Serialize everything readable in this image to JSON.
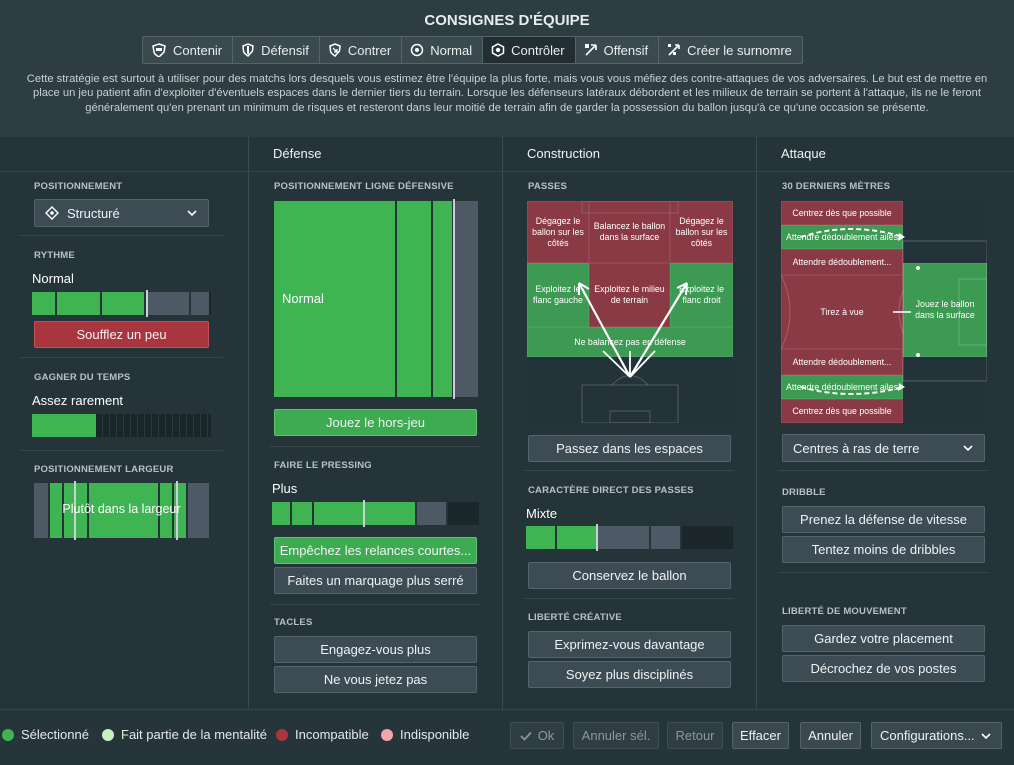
{
  "title": "CONSIGNES D'ÉQUIPE",
  "tabs": [
    {
      "label": "Contenir",
      "icon": "shield-hold-icon"
    },
    {
      "label": "Défensif",
      "icon": "shield-icon"
    },
    {
      "label": "Contrer",
      "icon": "counter-icon"
    },
    {
      "label": "Normal",
      "icon": "balance-icon"
    },
    {
      "label": "Contrôler",
      "icon": "control-icon",
      "active": true
    },
    {
      "label": "Offensif",
      "icon": "attack-icon"
    },
    {
      "label": "Créer le surnomre",
      "icon": "overload-icon"
    }
  ],
  "description": "Cette stratégie est surtout à utiliser pour des matchs lors desquels vous estimez être l'équipe la plus forte, mais vous vous méfiez des contre-attaques de vos adversaires. Le but est de mettre en place un jeu patient afin d'exploiter d'éventuels espaces dans le dernier tiers du terrain. Lorsque les défenseurs latéraux débordent et les milieux de terrain se portent à l'attaque, ils ne le feront généralement qu'en prenant un minimum de risques et resteront dans leur moitié de terrain afin de garder la possession du ballon jusqu'à ce qu'une occasion se présente.",
  "left": {
    "positioning_label": "POSITIONNEMENT",
    "positioning_value": "Structuré",
    "tempo_label": "RYTHME",
    "tempo_value": "Normal",
    "tempo_level": 0.6,
    "tempo_button": "Soufflez un peu",
    "timewasting_label": "GAGNER DU TEMPS",
    "timewasting_value": "Assez rarement",
    "timewasting_level": 0.35,
    "width_label": "POSITIONNEMENT LARGEUR",
    "width_value": "Plutôt dans la largeur"
  },
  "defense": {
    "header": "Défense",
    "line_label": "POSITIONNEMENT LIGNE DÉFENSIVE",
    "line_value": "Normal",
    "offside_button": "Jouez le hors-jeu",
    "press_label": "FAIRE LE PRESSING",
    "press_value": "Plus",
    "press_level": 0.71,
    "press_btn1": "Empêchez les relances courtes...",
    "press_btn2": "Faites un marquage plus serré",
    "tackle_label": "TACLES",
    "tackle_btn1": "Engagez-vous plus",
    "tackle_btn2": "Ne vous jetez pas"
  },
  "build": {
    "header": "Construction",
    "passes_label": "PASSES",
    "zones": {
      "tl": "Dégagez le ballon sur les côtés",
      "tc": "Balancez le ballon dans la surface",
      "tr": "Dégagez le ballon sur les côtés",
      "ml": "Exploitez le flanc gauche",
      "mc": "Exploitez le milieu de terrain",
      "mr": "Exploitez le flanc droit",
      "b": "Ne balancez pas en défense"
    },
    "spaces_button": "Passez dans les espaces",
    "direct_label": "CARACTÈRE DIRECT DES PASSES",
    "direct_value": "Mixte",
    "direct_level": 0.5,
    "keep_button": "Conservez le ballon",
    "creative_label": "LIBERTÉ CRÉATIVE",
    "creative_btn1": "Exprimez-vous davantage",
    "creative_btn2": "Soyez plus disciplinés"
  },
  "attack": {
    "header": "Attaque",
    "final_label": "30 DERNIERS MÈTRES",
    "zones": {
      "z1": "Centrez dès que possible",
      "z2": "Attendre dédoublement ailes",
      "z3": "Attendre dédoublement...",
      "z4": "Tirez à vue",
      "z5": "Attendre dédoublement...",
      "z6": "Attendre dédoublement ailes",
      "z7": "Centrez dès que possible",
      "z8": "Jouez le ballon dans la surface"
    },
    "cross_value": "Centres à ras de terre",
    "dribble_label": "DRIBBLE",
    "dribble_btn1": "Prenez la défense de vitesse",
    "dribble_btn2": "Tentez moins de dribbles",
    "movement_label": "LIBERTÉ DE MOUVEMENT",
    "movement_btn1": "Gardez votre placement",
    "movement_btn2": "Décrochez de vos postes"
  },
  "legend": [
    {
      "label": "Sélectionné",
      "color": "#3fb453"
    },
    {
      "label": "Fait partie de la mentalité",
      "color": "#c9f0c0"
    },
    {
      "label": "Incompatible",
      "color": "#a9353e"
    },
    {
      "label": "Indisponible",
      "color": "#f0a6a8"
    }
  ],
  "footer": {
    "ok": "Ok",
    "undo_sel": "Annuler sél.",
    "back": "Retour",
    "clear": "Effacer",
    "cancel": "Annuler",
    "configs": "Configurations..."
  }
}
